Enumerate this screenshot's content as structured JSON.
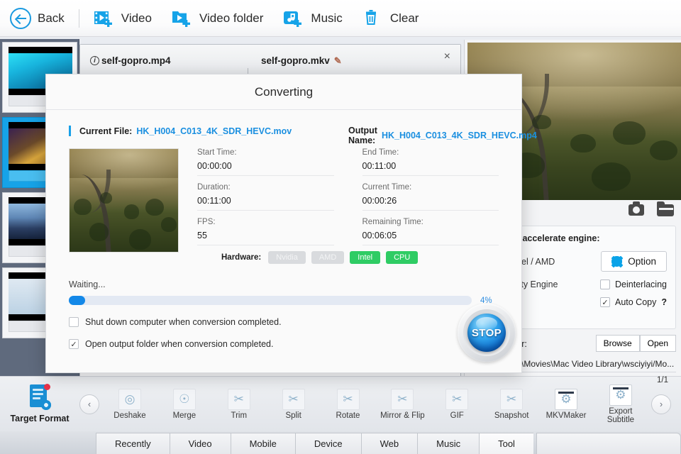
{
  "toolbar": {
    "items": [
      {
        "label": "Back",
        "icon": "back-arrow-icon"
      },
      {
        "label": "Video",
        "icon": "add-video-icon"
      },
      {
        "label": "Video folder",
        "icon": "add-video-folder-icon"
      },
      {
        "label": "Music",
        "icon": "add-music-icon"
      },
      {
        "label": "Clear",
        "icon": "trash-icon"
      }
    ]
  },
  "file_list": {
    "source_name": "self-gopro.mp4",
    "output_name": "self-gopro.mkv",
    "close_label": "×"
  },
  "preview": {
    "camera_icon": "camera-icon",
    "folder_icon": "folder-icon",
    "hardware_title": "Hardware accelerate engine:",
    "hardware_sub": "Nvidia / Intel / AMD",
    "quality_engine": "High Quality Engine",
    "option_label": "Option",
    "deinterlacing_label": "Deinterlacing",
    "deinterlacing_checked": false,
    "auto_copy_label": "Auto Copy",
    "auto_copy_help": "?",
    "auto_copy_checked": true,
    "output_folder_label": "Output Folder:",
    "browse_label": "Browse",
    "open_label": "Open",
    "output_path": "C:\\Users\\new\\Movies\\Mac Video Library\\wsciyiyi/Mo..."
  },
  "dialog": {
    "title": "Converting",
    "current_file_label": "Current File:",
    "current_file_value": "HK_H004_C013_4K_SDR_HEVC.mov",
    "output_name_label": "Output Name:",
    "output_name_value": "HK_H004_C013_4K_SDR_HEVC.mp4",
    "fields": [
      {
        "label": "Start Time:",
        "value": "00:00:00"
      },
      {
        "label": "End Time:",
        "value": "00:11:00"
      },
      {
        "label": "Duration:",
        "value": "00:11:00"
      },
      {
        "label": "Current Time:",
        "value": "00:00:26"
      },
      {
        "label": "FPS:",
        "value": "55"
      },
      {
        "label": "Remaining Time:",
        "value": "00:06:05"
      }
    ],
    "hardware_label": "Hardware:",
    "hardware_badges": [
      {
        "label": "Nvidia",
        "active": false
      },
      {
        "label": "AMD",
        "active": false
      },
      {
        "label": "Intel",
        "active": true
      },
      {
        "label": "CPU",
        "active": true
      }
    ],
    "status": "Waiting...",
    "progress_percent": 4,
    "progress_percent_label": "4%",
    "options": [
      {
        "label": "Shut down computer when conversion completed.",
        "checked": false
      },
      {
        "label": "Open output folder when conversion completed.",
        "checked": true
      }
    ],
    "stop_label": "STOP"
  },
  "tool_strip": {
    "target_format_label": "Target Format",
    "prev_label": "‹",
    "next_label": "›",
    "tools": [
      {
        "label": "Deshake",
        "icon": "deshake-icon"
      },
      {
        "label": "Merge",
        "icon": "merge-icon"
      },
      {
        "label": "Trim",
        "icon": "trim-icon"
      },
      {
        "label": "Split",
        "icon": "split-icon"
      },
      {
        "label": "Rotate",
        "icon": "rotate-icon"
      },
      {
        "label": "Mirror & Flip",
        "icon": "mirror-flip-icon"
      },
      {
        "label": "GIF",
        "icon": "gif-icon"
      },
      {
        "label": "Snapshot",
        "icon": "snapshot-icon"
      },
      {
        "label": "MKVMaker",
        "icon": "mkvmaker-icon"
      },
      {
        "label": "Export Subtitle",
        "icon": "export-subtitle-icon"
      }
    ]
  },
  "tabs": {
    "items": [
      "Recently",
      "Video",
      "Mobile",
      "Device",
      "Web",
      "Music",
      "Tool"
    ],
    "active": "Tool"
  },
  "page_indicator": "1/1",
  "colors": {
    "accent_blue": "#1a8fe0",
    "progress_blue": "#1388e8",
    "badge_green": "#2fcc64",
    "badge_gray": "#d9dbde"
  }
}
